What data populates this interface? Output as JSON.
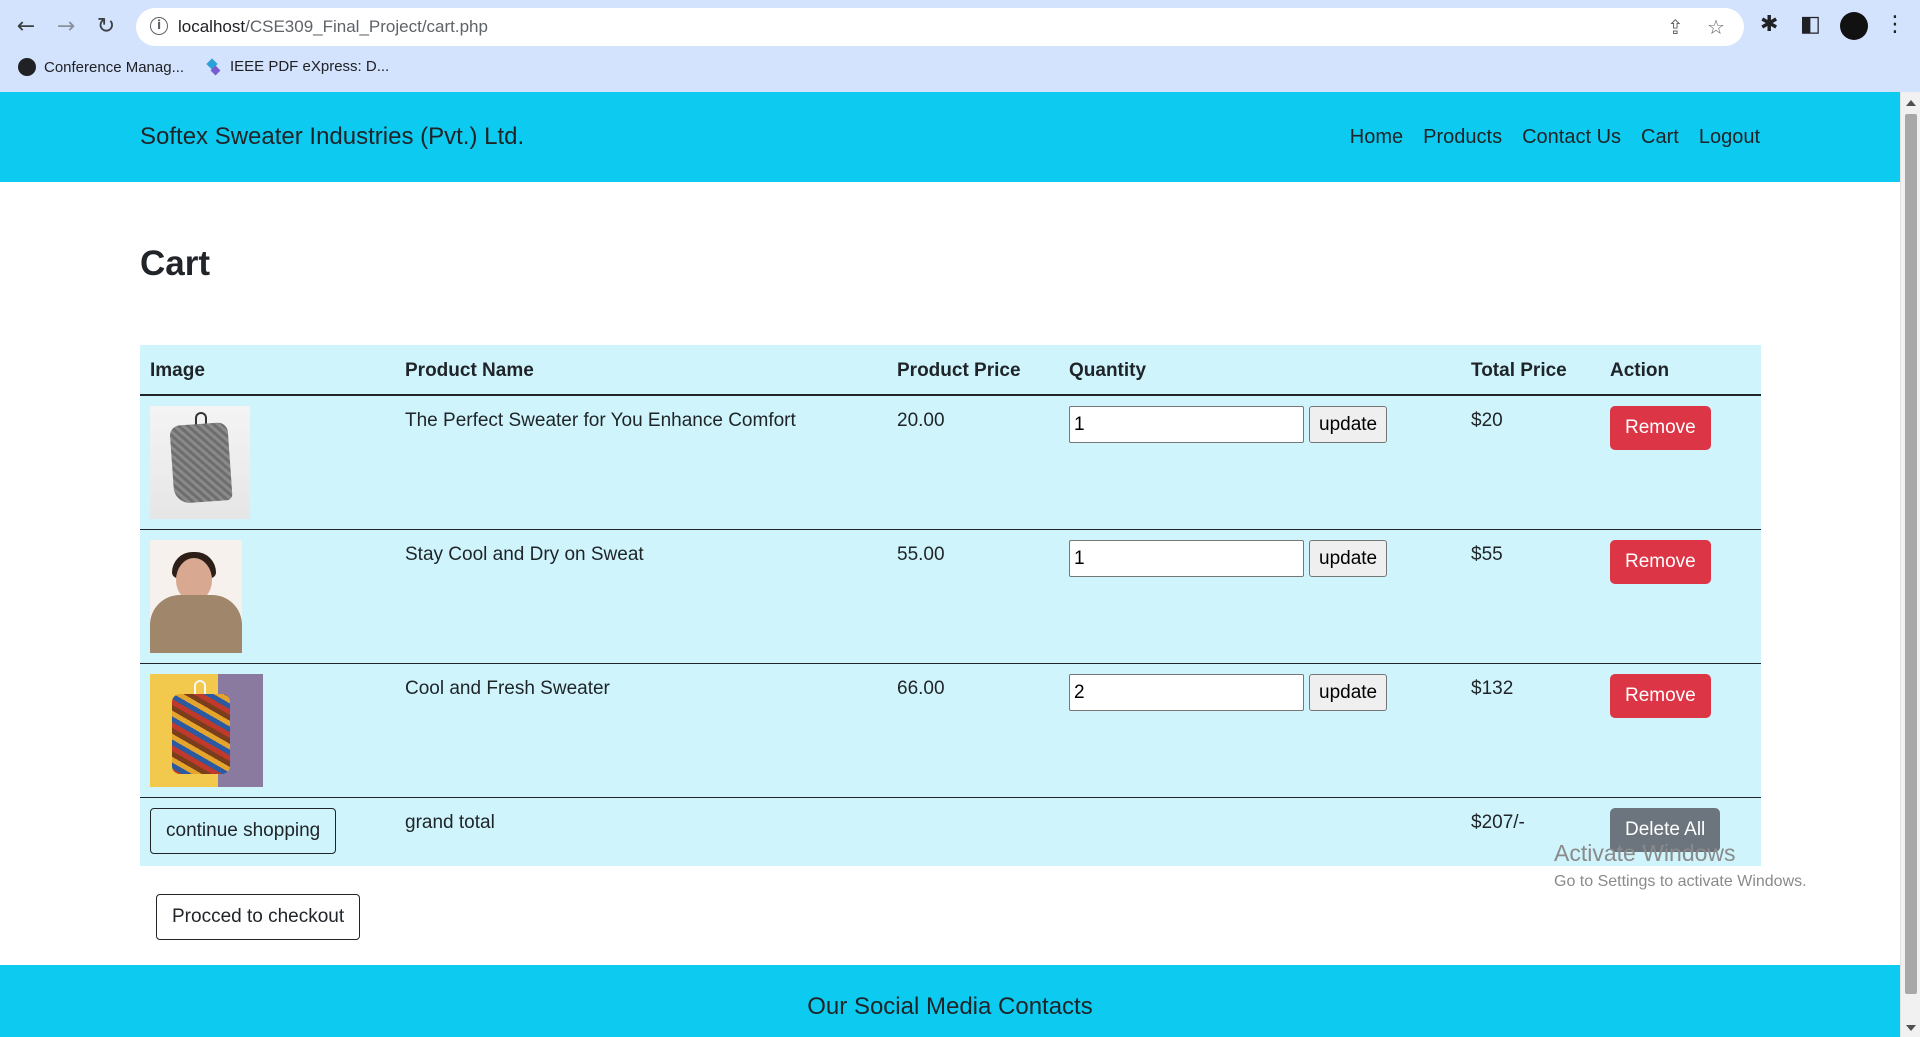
{
  "browser": {
    "url_host": "localhost",
    "url_path": "/CSE309_Final_Project/cart.php",
    "bookmarks": [
      "Conference Manag...",
      "IEEE PDF eXpress: D..."
    ]
  },
  "navbar": {
    "brand": "Softex Sweater Industries (Pvt.) Ltd.",
    "links": [
      "Home",
      "Products",
      "Contact Us",
      "Cart",
      "Logout"
    ]
  },
  "page": {
    "title": "Cart"
  },
  "table": {
    "headers": [
      "Image",
      "Product Name",
      "Product Price",
      "Quantity",
      "Total Price",
      "Action"
    ],
    "rows": [
      {
        "name": "The Perfect Sweater for You Enhance Comfort",
        "price": "20.00",
        "quantity": "1",
        "total": "$20"
      },
      {
        "name": "Stay Cool and Dry on Sweat",
        "price": "55.00",
        "quantity": "1",
        "total": "$55"
      },
      {
        "name": "Cool and Fresh Sweater",
        "price": "66.00",
        "quantity": "2",
        "total": "$132"
      }
    ],
    "update_label": "update",
    "remove_label": "Remove",
    "continue_label": "continue shopping",
    "grand_total_label": "grand total",
    "grand_total_value": "$207/-",
    "delete_all_label": "Delete All"
  },
  "checkout_label": "Procced to checkout",
  "footer": {
    "title": "Our Social Media Contacts"
  },
  "watermark": {
    "line1": "Activate Windows",
    "line2": "Go to Settings to activate Windows."
  },
  "colors": {
    "navbar": "#0dcaf0",
    "table_bg": "#cff4fc",
    "danger": "#dc3545",
    "secondary": "#6c757d"
  }
}
